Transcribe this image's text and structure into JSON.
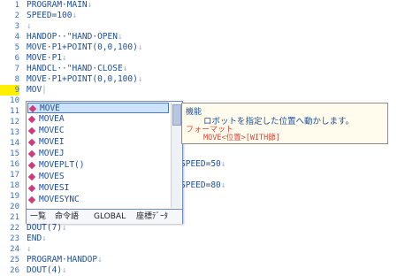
{
  "lines": [
    {
      "n": "1",
      "text": "PROGRAM·MAIN"
    },
    {
      "n": "2",
      "text": "SPEED=100"
    },
    {
      "n": "3",
      "text": ""
    },
    {
      "n": "4",
      "text": "HANDOP··\"HAND·OPEN"
    },
    {
      "n": "5",
      "text": "MOVE·P1+POINT(0,0,100)"
    },
    {
      "n": "6",
      "text": "MOVE·P1"
    },
    {
      "n": "7",
      "text": "HANDCL··\"HAND·CLOSE"
    },
    {
      "n": "8",
      "text": "MOVE·P1+POINT(0,0,100)"
    },
    {
      "n": "9",
      "text": "MOV"
    },
    {
      "n": "10",
      "text": ""
    },
    {
      "n": "11",
      "text": ""
    },
    {
      "n": "12",
      "text": ""
    },
    {
      "n": "13",
      "text": ""
    },
    {
      "n": "14",
      "text": ""
    },
    {
      "n": "15",
      "text": ""
    },
    {
      "n": "16",
      "text": "SPEED=50"
    },
    {
      "n": "17",
      "text": ""
    },
    {
      "n": "18",
      "text": "SPEED=80"
    },
    {
      "n": "19",
      "text": ""
    },
    {
      "n": "20",
      "text": ""
    },
    {
      "n": "21",
      "text": ""
    },
    {
      "n": "22",
      "text": "DOUT(7)"
    },
    {
      "n": "23",
      "text": "END"
    },
    {
      "n": "24",
      "text": ""
    },
    {
      "n": "25",
      "text": "PROGRAM·HANDOP"
    },
    {
      "n": "26",
      "text": "DOUT(4)"
    }
  ],
  "line_end_mark": "↓",
  "completion": {
    "items": [
      "MOVE",
      "MOVEA",
      "MOVEC",
      "MOVEI",
      "MOVEJ",
      "MOVEPLT()",
      "MOVES",
      "MOVESI",
      "MOVESYNC"
    ],
    "selected_index": 0,
    "tabs": [
      "一覧",
      "命令語",
      "GLOBAL",
      "座標ﾃﾞｰﾀ"
    ]
  },
  "tooltip": {
    "heading": "機能",
    "description": "ロボットを指定した位置へ動かします。",
    "format_heading": "フォーマット",
    "format": "MOVE<位置>[WITH節]"
  },
  "colors": {
    "accent": "#1e4f9a",
    "string": "#d04a7c",
    "cursor_line": "#ffef00",
    "selection": "#cde3fb"
  }
}
